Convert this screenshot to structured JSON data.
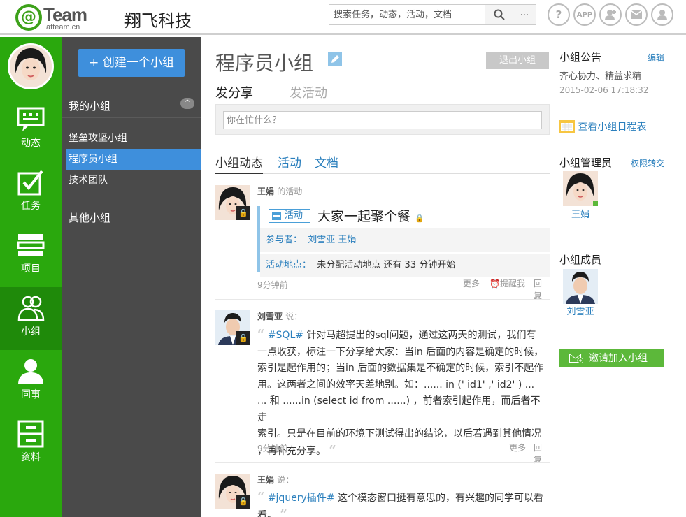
{
  "header": {
    "logo_word": "Team",
    "logo_site": "atteam.cn",
    "company": "翔飞科技",
    "search_placeholder": "搜索任务，动态，活动，文档",
    "more_label": "...",
    "icons": [
      "help-icon",
      "app-icon",
      "add-contact-icon",
      "mail-icon",
      "user-icon"
    ],
    "app_label": "APP"
  },
  "nav": {
    "items": [
      {
        "label": "动态",
        "icon": "chat-icon"
      },
      {
        "label": "任务",
        "icon": "checkbox-icon"
      },
      {
        "label": "项目",
        "icon": "project-icon"
      },
      {
        "label": "小组",
        "icon": "group-icon"
      },
      {
        "label": "同事",
        "icon": "colleague-icon"
      },
      {
        "label": "资料",
        "icon": "cabinet-icon"
      }
    ],
    "active": "小组"
  },
  "groups_panel": {
    "create_label": "+ 创建一个小组",
    "my_groups_title": "我的小组",
    "collapse_label": "^",
    "my_groups": [
      "堡垒攻坚小组",
      "程序员小组",
      "技术团队"
    ],
    "selected": "程序员小组",
    "other_groups_title": "其他小组"
  },
  "main": {
    "title": "程序员小组",
    "quit_label": "退出小组",
    "post_tabs": [
      "发分享",
      "发活动"
    ],
    "post_placeholder": "你在忙什么？",
    "feed_tabs": [
      "小组动态",
      "活动",
      "文档"
    ],
    "feed": [
      {
        "author": "王娟",
        "action": "的活动",
        "tag": "活动",
        "title": "大家一起聚个餐",
        "participants_key": "参与者：",
        "participants": "刘雪亚   王娟",
        "location_key": "活动地点：",
        "location": "未分配活动地点 还有 33 分钟开始",
        "time": "9分钟前",
        "more": "更多",
        "remind": "提醒我",
        "reply": "回复"
      },
      {
        "author": "刘雪亚",
        "action": "说：",
        "hashtag": "#SQL#",
        "lines": [
          "针对马超提出的sql问题，通过这两天的测试，我们有",
          "一点收获，标注一下分享给大家：当in 后面的内容是确定的时候，",
          "索引是起作用的；当in 后面的数据集是不确定的时候，索引不起作",
          "用。这两者之间的效率天差地别。如：...... in (' id1' ,' id2' ) ...",
          "... 和 ......in (select id from ......) ，前者索引起作用，而后者不走",
          "索引。只是在目前的环境下测试得出的结论，以后若遇到其他情况",
          "，再补充分享。"
        ],
        "time": "9分钟前",
        "more": "更多",
        "reply": "回复"
      },
      {
        "author": "王娟",
        "action": "说：",
        "hashtag": "#jquery插件#",
        "lines": [
          "这个模态窗口挺有意思的，有兴趣的同学可以看看。"
        ]
      }
    ]
  },
  "right": {
    "notice_title": "小组公告",
    "notice_edit": "编辑",
    "notice_text": "齐心协力、精益求精",
    "notice_date": "2015-02-06 17:18:32",
    "calendar_link": "查看小组日程表",
    "admin_title": "小组管理员",
    "admin_transfer": "权限转交",
    "admin_name": "王娟",
    "members_title": "小组成员",
    "member_name": "刘雪亚",
    "invite_label": "邀请加入小组"
  },
  "colors": {
    "nav_green": "#2aa80d",
    "accent_blue": "#3e8fdc",
    "link_blue": "#2a7fbd",
    "invite_green": "#5cb83a"
  }
}
